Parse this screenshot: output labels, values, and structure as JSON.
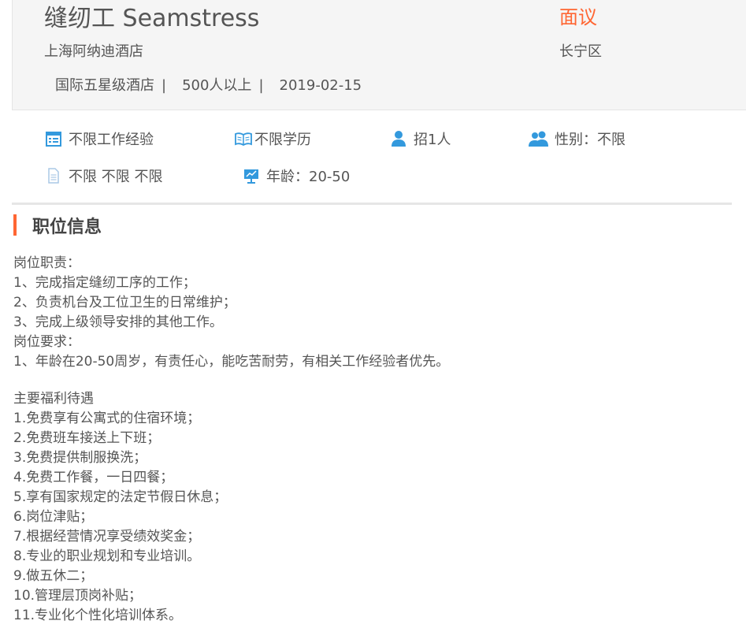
{
  "job": {
    "title": "缝纫工 Seamstress",
    "salary": "面议",
    "company": "上海阿纳迪酒店",
    "district": "长宁区",
    "company_type": "国际五星级酒店",
    "company_size": "500人以上",
    "date": "2019-02-15",
    "separator": "|"
  },
  "requirements": {
    "experience": "不限工作经验",
    "education": "不限学历",
    "headcount": "招1人",
    "gender": "性别：不限",
    "other": "不限 不限 不限",
    "age": "年龄：20-50"
  },
  "icons": {
    "experience": "calendar-icon",
    "education": "book-icon",
    "headcount": "person-icon",
    "gender": "people-icon",
    "other": "document-icon",
    "age": "presentation-icon"
  },
  "colors": {
    "accent": "#ff6633",
    "icon": "#3399dd"
  },
  "section": {
    "title": "职位信息"
  },
  "description": [
    "岗位职责：",
    "1、完成指定缝纫工序的工作；",
    "2、负责机台及工位卫生的日常维护；",
    "3、完成上级领导安排的其他工作。",
    "岗位要求：",
    "1、年龄在20-50周岁，有责任心，能吃苦耐劳，有相关工作经验者优先。",
    "",
    "主要福利待遇",
    "1.免费享有公寓式的住宿环境；",
    "2.免费班车接送上下班；",
    "3.免费提供制服换洗；",
    "4.免费工作餐，一日四餐；",
    "5.享有国家规定的法定节假日休息；",
    "6.岗位津贴；",
    "7.根据经营情况享受绩效奖金；",
    "8.专业的职业规划和专业培训。",
    "9.做五休二；",
    "10.管理层顶岗补贴；",
    "11.专业化个性化培训体系。"
  ]
}
